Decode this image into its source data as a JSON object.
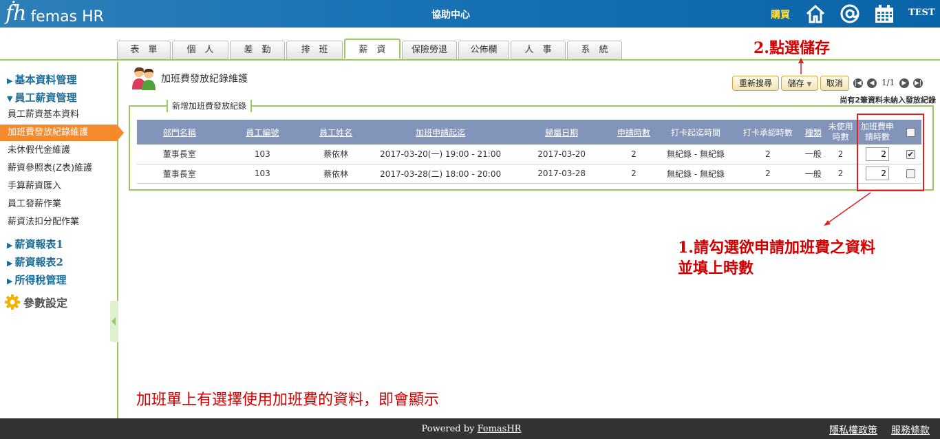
{
  "header": {
    "logo_mark": "ḟh",
    "logo_text": "femas HR",
    "help_center": "協助中心",
    "buy": "購買",
    "user": "TEST",
    "icons": [
      "home-icon",
      "at-icon",
      "calendar-icon"
    ],
    "color_bar": "#1a73b5",
    "color_buy": "#ffe14a"
  },
  "tabs": [
    {
      "label": "表　單",
      "w": 78
    },
    {
      "label": "個　人",
      "w": 82
    },
    {
      "label": "差　勤",
      "w": 80
    },
    {
      "label": "排　班",
      "w": 82
    },
    {
      "label": "薪　資",
      "w": 82,
      "active": true
    },
    {
      "label": "保險勞退",
      "w": 80
    },
    {
      "label": "公佈欄",
      "w": 74
    },
    {
      "label": "人　事",
      "w": 80
    },
    {
      "label": "系　統",
      "w": 80
    }
  ],
  "sidebar": {
    "group_basic": "基本資料管理",
    "group_salary": "員工薪資管理",
    "items": [
      "員工薪資基本資料",
      "加班費發放紀錄維護",
      "未休假代金維護",
      "薪資參照表(Z表)維護",
      "手算薪資匯入",
      "員工發薪作業",
      "薪資法扣分配作業"
    ],
    "group_report1": "薪資報表1",
    "group_report2": "薪資報表2",
    "group_tax": "所得稅管理",
    "param": "參數設定",
    "arrow_open": "▼",
    "arrow_closed": "▶"
  },
  "page": {
    "title": "加班費發放紀錄維護",
    "btn_research": "重新搜尋",
    "btn_save": "儲存",
    "btn_cancel": "取消",
    "page_info": "1/1",
    "notice": "尚有2筆資料未納入發放紀錄",
    "legend": "新增加班費發放紀錄"
  },
  "table": {
    "headers": [
      "部門名稱",
      "員工編號",
      "員工姓名",
      "加班申請起迄",
      "歸屬日期",
      "申請時數",
      "打卡起迄時間",
      "打卡承認時數",
      "種類",
      "未使用時數",
      "加班費申請時數"
    ],
    "rows": [
      {
        "dept": "董事長室",
        "id": "103",
        "name": "蔡依林",
        "range": "2017-03-20(一) 19:00 - 21:00",
        "date": "2017-03-20",
        "apply": "2",
        "punch": "無紀錄 - 無紀錄",
        "approved": "2",
        "type": "一般",
        "unused": "2",
        "hours": "2",
        "checked": true
      },
      {
        "dept": "董事長室",
        "id": "103",
        "name": "蔡依林",
        "range": "2017-03-28(二) 18:00 - 20:00",
        "date": "2017-03-28",
        "apply": "2",
        "punch": "無紀錄 - 無紀錄",
        "approved": "2",
        "type": "一般",
        "unused": "2",
        "hours": "2",
        "checked": false
      }
    ],
    "header_color": "#8294ba"
  },
  "annotations": {
    "step1_line1": "1.請勾選欲申請加班費之資料",
    "step1_line2": "並填上時數",
    "step2": "2.點選儲存",
    "note": "加班單上有選擇使用加班費的資料，即會顯示",
    "color": "#d00000"
  },
  "footer": {
    "powered_prefix": "Powered by ",
    "powered_link": "FemasHR",
    "privacy": "隱私權政策",
    "terms": "服務條款"
  }
}
